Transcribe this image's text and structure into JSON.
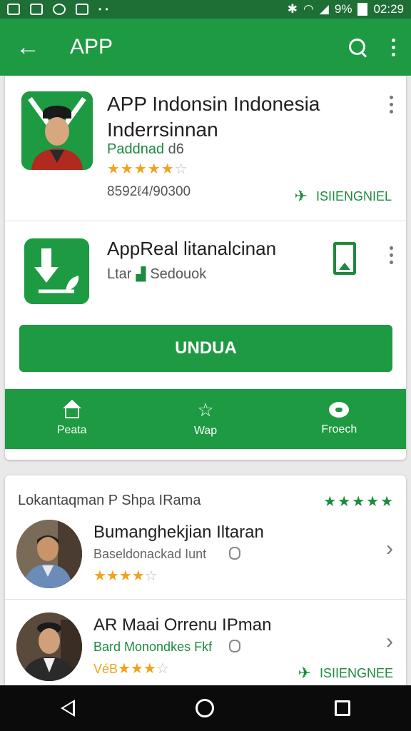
{
  "status_bar": {
    "battery": "9%",
    "time": "02:29"
  },
  "app_bar": {
    "title": "APP"
  },
  "featured": [
    {
      "name": "APP Indonsin Indonesia Inderrsinnan",
      "developer": "Paddnad",
      "developer_suffix": "d6",
      "rating_filled": "★★★★★",
      "rating_empty": "☆",
      "downloads": "8592ℓ4/90300",
      "install_label": "ISIIENGNIEL"
    },
    {
      "name": "AppReal litanalcinan",
      "sub_prefix": "Ltar",
      "sub_label": "Sedouok"
    }
  ],
  "install_button": {
    "label": "UNDUA"
  },
  "tabs": [
    {
      "label": "Peata",
      "icon": "home-icon"
    },
    {
      "label": "Wap",
      "icon": "star-icon"
    },
    {
      "label": "Froech",
      "icon": "chat-icon"
    }
  ],
  "list_section": {
    "header": "Lokantaqman P Shpa IRama",
    "header_rating": "★★★★★",
    "items": [
      {
        "title": "Bumanghekjian Iltaran",
        "subtitle": "Baseldonackad Iunt",
        "rating_prefix": "",
        "rating_filled": "★★★★",
        "rating_empty": "☆",
        "install_label": ""
      },
      {
        "title": "AR Maai Orrenu IPman",
        "subtitle": "Bard Monondkes Fkf",
        "rating_prefix": "VéB",
        "rating_filled": "★★★",
        "rating_empty": "☆",
        "install_label": "ISIIENGNEE"
      }
    ]
  },
  "colors": {
    "accent": "#1d9a42",
    "accent_dark": "#1d8a3e",
    "status_bar": "#1e6f35",
    "star": "#f0a21a"
  }
}
